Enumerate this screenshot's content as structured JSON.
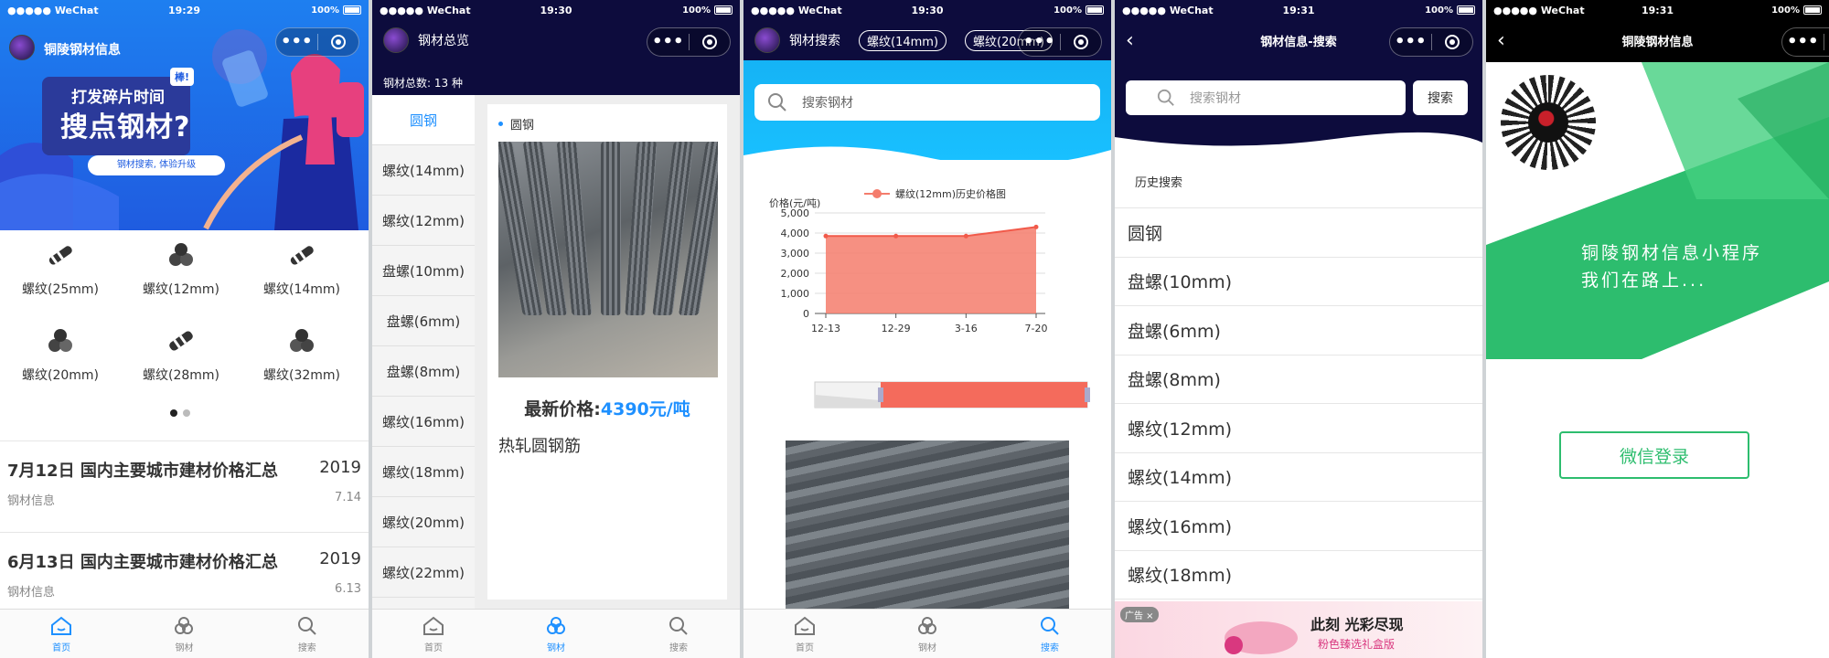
{
  "status": {
    "carrier": "●●●●● WeChat",
    "battery": "100%"
  },
  "screen1": {
    "time": "19:29",
    "nav_title": "铜陵钢材信息",
    "banner": {
      "line1": "打发碎片时间",
      "line2": "搜点钢材?",
      "tag": "棒!",
      "pill": "钢材搜索, 体验升级"
    },
    "grid": [
      {
        "label": "螺纹(25mm)"
      },
      {
        "label": "螺纹(12mm)"
      },
      {
        "label": "螺纹(14mm)"
      },
      {
        "label": "螺纹(20mm)"
      },
      {
        "label": "螺纹(28mm)"
      },
      {
        "label": "螺纹(32mm)"
      }
    ],
    "news": [
      {
        "title": "7月12日 国内主要城市建材价格汇总",
        "year": "2019",
        "source": "钢材信息",
        "date": "7.14"
      },
      {
        "title": "6月13日 国内主要城市建材价格汇总",
        "year": "2019",
        "source": "钢材信息",
        "date": "6.13"
      }
    ]
  },
  "tabs": {
    "home": "首页",
    "steel": "钢材",
    "search": "搜索"
  },
  "screen2": {
    "time": "19:30",
    "nav_title": "钢材总览",
    "count": "钢材总数: 13 种",
    "side": [
      "圆钢",
      "螺纹(14mm)",
      "螺纹(12mm)",
      "盘螺(10mm)",
      "盘螺(6mm)",
      "盘螺(8mm)",
      "螺纹(16mm)",
      "螺纹(18mm)",
      "螺纹(20mm)",
      "螺纹(22mm)"
    ],
    "card_title": "圆钢",
    "price_label": "最新价格:",
    "price_value": "4390元/吨",
    "product_name": "热轧圆钢筋"
  },
  "screen3": {
    "time": "19:30",
    "nav_title": "钢材搜索",
    "chips": [
      "螺纹(14mm)",
      "螺纹(20mm)"
    ],
    "search_placeholder": "搜索钢材",
    "chart_data": {
      "type": "area",
      "title": "",
      "ylabel": "价格(元/吨)",
      "legend": "螺纹(12mm)历史价格图",
      "categories": [
        "12-13",
        "12-29",
        "3-16",
        "7-20"
      ],
      "values": [
        3850,
        3850,
        3850,
        4300
      ],
      "ylim": [
        0,
        5000
      ],
      "yticks": [
        "0",
        "1,000",
        "2,000",
        "3,000",
        "4,000",
        "5,000"
      ],
      "color": "#f47c6c"
    }
  },
  "screen4": {
    "time": "19:31",
    "nav_title": "钢材信息-搜索",
    "search_placeholder": "搜索钢材",
    "search_button": "搜索",
    "history_label": "历史搜索",
    "results": [
      "圆钢",
      "盘螺(10mm)",
      "盘螺(6mm)",
      "盘螺(8mm)",
      "螺纹(12mm)",
      "螺纹(14mm)",
      "螺纹(16mm)",
      "螺纹(18mm)"
    ],
    "ad": {
      "label": "广告",
      "line1": "此刻 光彩尽现",
      "line2": "粉色臻选礼盒版"
    }
  },
  "screen5": {
    "time": "19:31",
    "nav_title": "铜陵钢材信息",
    "slogan1": "铜陵钢材信息小程序",
    "slogan2": "我们在路上...",
    "login_button": "微信登录",
    "brand_green": "#2dbd6e"
  }
}
